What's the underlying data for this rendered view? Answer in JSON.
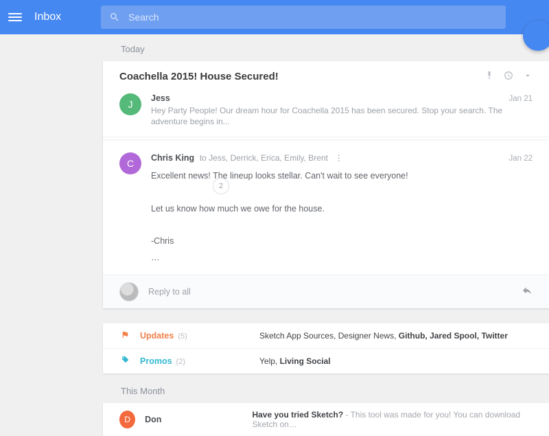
{
  "header": {
    "app_title": "Inbox",
    "search_placeholder": "Search"
  },
  "sections": {
    "today": "Today",
    "this_month": "This Month"
  },
  "thread": {
    "title": "Coachella 2015! House Secured!",
    "collapsed_count": "2",
    "messages": [
      {
        "sender": "Jess",
        "initial": "J",
        "color": "#55b979",
        "date": "Jan 21",
        "preview": "Hey Party People! Our dream hour for Coachella 2015 has been secured. Stop your search. The adventure begins in..."
      },
      {
        "sender": "Chris King",
        "recipients": "to Jess, Derrick, Erica, Emily, Brent",
        "initial": "C",
        "color": "#b168d8",
        "date": "Jan 22",
        "body": "Excellent news! The lineup looks stellar. Can't wait to see everyone!\n\nLet us know how much we owe for the house.\n\n-Chris\n…"
      }
    ],
    "reply_placeholder": "Reply to all"
  },
  "bundles": [
    {
      "name": "Updates",
      "count": "(5)",
      "color": "#f3804a",
      "icon": "flag",
      "summary_plain": "Sketch App Sources, Designer News, ",
      "summary_bold": "Github, Jared Spool, Twitter"
    },
    {
      "name": "Promos",
      "count": "(2)",
      "color": "#32b8d0",
      "icon": "tag",
      "summary_plain": "Yelp, ",
      "summary_bold": "Living Social"
    }
  ],
  "month_row": {
    "sender": "Don",
    "initial": "D",
    "color": "#f36a3e",
    "subject": "Have you tried Sketch?",
    "snippet": " - This tool was made for you! You can download Sketch on…"
  }
}
